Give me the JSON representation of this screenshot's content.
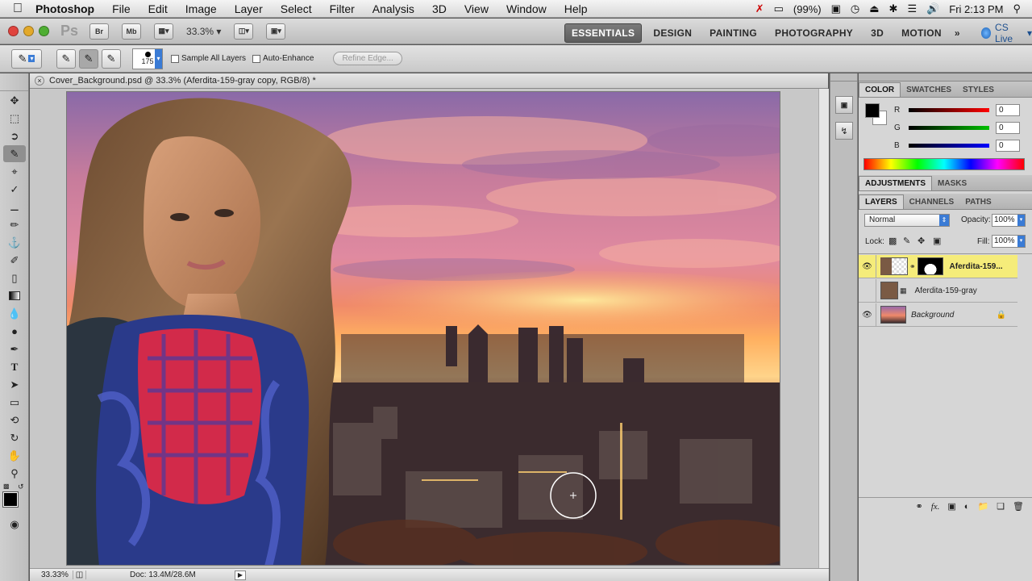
{
  "menubar": {
    "app_name": "Photoshop",
    "menus": [
      "File",
      "Edit",
      "Image",
      "Layer",
      "Select",
      "Filter",
      "Analysis",
      "3D",
      "View",
      "Window",
      "Help"
    ],
    "battery": "(99%)",
    "clock": "Fri 2:13 PM"
  },
  "appbar": {
    "logo": "Ps",
    "bridge": "Br",
    "minibridge": "Mb",
    "zoom": "33.3%",
    "workspaces": [
      "ESSENTIALS",
      "DESIGN",
      "PAINTING",
      "PHOTOGRAPHY",
      "3D",
      "MOTION"
    ],
    "more": "»",
    "cs_live": "CS Live"
  },
  "options": {
    "brush_size": "175",
    "sample_all_layers": "Sample All Layers",
    "auto_enhance": "Auto-Enhance",
    "refine_edge": "Refine Edge..."
  },
  "document": {
    "tab_title": "Cover_Background.psd @ 33.3% (Aferdita-159-gray copy, RGB/8) *",
    "status_zoom": "33.33%",
    "doc_size": "Doc: 13.4M/28.6M"
  },
  "color_panel": {
    "tabs": [
      "COLOR",
      "SWATCHES",
      "STYLES"
    ],
    "channels": [
      {
        "label": "R",
        "value": "0",
        "color": "#ff0000"
      },
      {
        "label": "G",
        "value": "0",
        "color": "#00c000"
      },
      {
        "label": "B",
        "value": "0",
        "color": "#0000ff"
      }
    ]
  },
  "adjust_panel": {
    "tabs": [
      "ADJUSTMENTS",
      "MASKS"
    ]
  },
  "layers_panel": {
    "tabs": [
      "LAYERS",
      "CHANNELS",
      "PATHS"
    ],
    "blend_mode": "Normal",
    "opacity_label": "Opacity:",
    "opacity": "100%",
    "lock_label": "Lock:",
    "fill_label": "Fill:",
    "fill": "100%",
    "layers": [
      {
        "name": "Aferdita-159...",
        "visible": true,
        "selected": true
      },
      {
        "name": "Aferdita-159-gray",
        "visible": false,
        "selected": false
      },
      {
        "name": "Background",
        "visible": true,
        "selected": false
      }
    ]
  },
  "colors": {
    "selected_layer": "#f5ec7a",
    "foreground": "#000000"
  }
}
